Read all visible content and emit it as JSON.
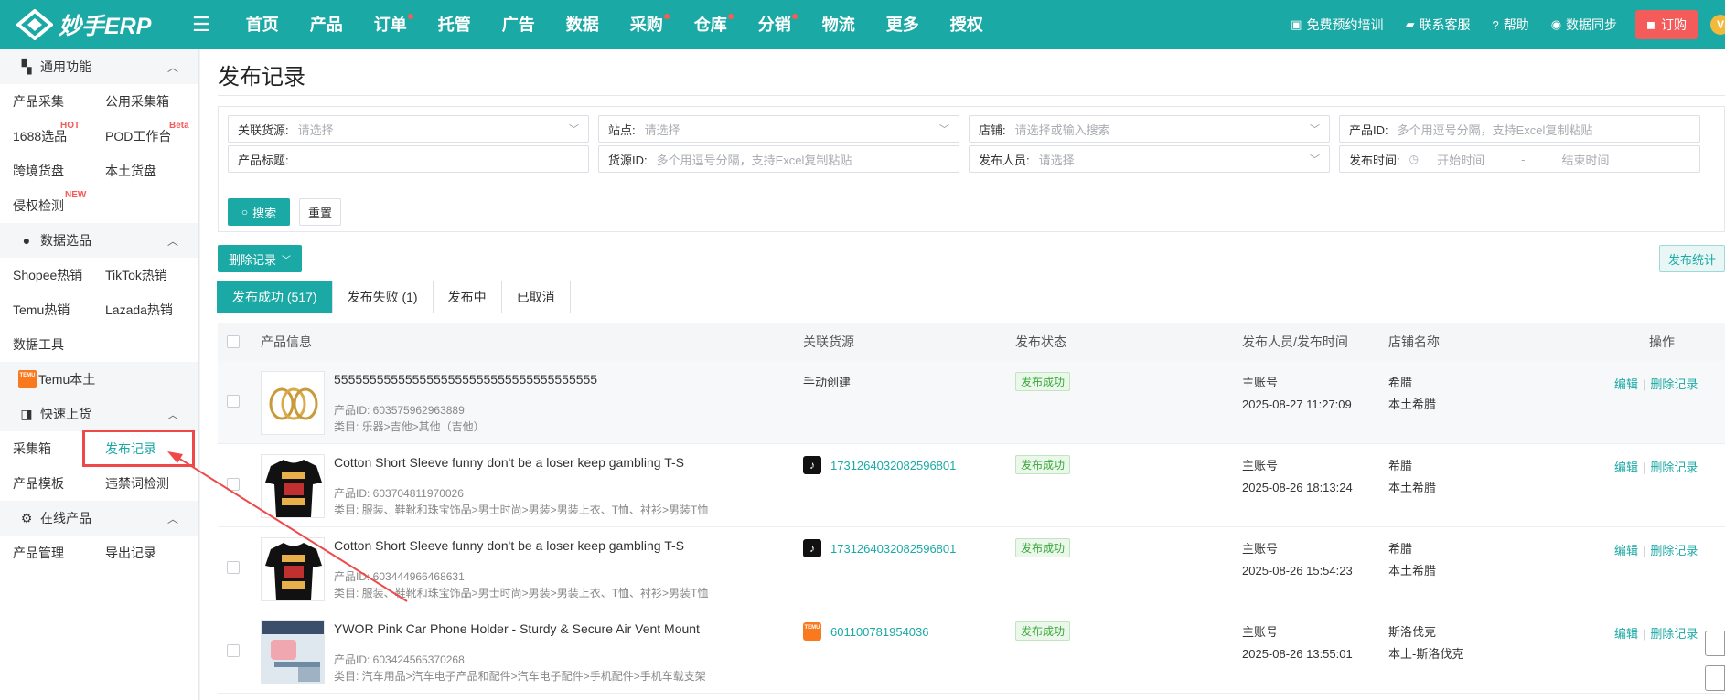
{
  "app": {
    "logo_text": "妙手ERP",
    "nav": [
      {
        "label": "首页",
        "dot": false
      },
      {
        "label": "产品",
        "dot": false
      },
      {
        "label": "订单",
        "dot": true
      },
      {
        "label": "托管",
        "dot": false
      },
      {
        "label": "广告",
        "dot": false
      },
      {
        "label": "数据",
        "dot": false
      },
      {
        "label": "采购",
        "dot": true
      },
      {
        "label": "仓库",
        "dot": true
      },
      {
        "label": "分销",
        "dot": true
      },
      {
        "label": "物流",
        "dot": false
      },
      {
        "label": "更多",
        "dot": false
      },
      {
        "label": "授权",
        "dot": false
      }
    ],
    "top_right": {
      "training": "免费预约培训",
      "support": "联系客服",
      "help": "帮助",
      "sync": "数据同步",
      "order": "订购",
      "vip": "V"
    }
  },
  "sidebar": {
    "sections": [
      {
        "title": "通用功能",
        "icon": "grid-icon",
        "items": [
          {
            "label": "产品采集"
          },
          {
            "label": "公用采集箱"
          },
          {
            "label": "1688选品",
            "tag": "HOT"
          },
          {
            "label": "POD工作台",
            "tag": "Beta"
          },
          {
            "label": "跨境货盘"
          },
          {
            "label": "本土货盘"
          },
          {
            "label": "侵权检测",
            "tag": "NEW"
          }
        ]
      },
      {
        "title": "数据选品",
        "icon": "thumb-icon",
        "items": [
          {
            "label": "Shopee热销"
          },
          {
            "label": "TikTok热销"
          },
          {
            "label": "Temu热销"
          },
          {
            "label": "Lazada热销"
          },
          {
            "label": "数据工具"
          }
        ]
      },
      {
        "title": "快速上货",
        "icon": "bag-icon",
        "items": [
          {
            "label": "采集箱"
          },
          {
            "label": "发布记录",
            "active": true
          },
          {
            "label": "产品模板"
          },
          {
            "label": "违禁词检测"
          }
        ]
      },
      {
        "title": "在线产品",
        "icon": "gear-icon",
        "items": [
          {
            "label": "产品管理"
          },
          {
            "label": "导出记录"
          }
        ]
      }
    ],
    "temu_local": {
      "label": "Temu本土",
      "logo": "TEMU"
    }
  },
  "main": {
    "title": "发布记录",
    "filters": {
      "source": {
        "label": "关联货源:",
        "placeholder": "请选择"
      },
      "site": {
        "label": "站点:",
        "placeholder": "请选择"
      },
      "shop": {
        "label": "店铺:",
        "placeholder": "请选择或输入搜索"
      },
      "product_id": {
        "label": "产品ID:",
        "placeholder": "多个用逗号分隔，支持Excel复制粘贴"
      },
      "product_title": {
        "label": "产品标题:",
        "placeholder": ""
      },
      "source_id": {
        "label": "货源ID:",
        "placeholder": "多个用逗号分隔，支持Excel复制粘贴"
      },
      "publisher": {
        "label": "发布人员:",
        "placeholder": "请选择"
      },
      "publish_time": {
        "label": "发布时间:",
        "start": "开始时间",
        "sep": "-",
        "end": "结束时间"
      }
    },
    "search_label": "搜索",
    "reset_label": "重置",
    "delete_label": "删除记录",
    "stats_label": "发布统计",
    "tabs": [
      {
        "label": "发布成功 (517)",
        "active": true
      },
      {
        "label": "发布失败 (1)",
        "active": false
      },
      {
        "label": "发布中",
        "active": false
      },
      {
        "label": "已取消",
        "active": false
      }
    ],
    "table": {
      "headers": {
        "product": "产品信息",
        "source": "关联货源",
        "status": "发布状态",
        "publisher": "发布人员/发布时间",
        "shop": "店铺名称",
        "ops": "操作"
      },
      "rows": [
        {
          "title": "5555555555555555555555555555555555555",
          "pid": "产品ID: 603575962963889",
          "category": "类目: 乐器>吉他>其他（吉他）",
          "source_type": "manual",
          "source": "手动创建",
          "status": "发布成功",
          "publisher": "主账号",
          "time": "2025-08-27 11:27:09",
          "shop1": "希腊",
          "shop2": "本土希腊",
          "thumb": "rings"
        },
        {
          "title": "Cotton Short Sleeve funny don't be a loser keep gambling T-S",
          "pid": "产品ID: 603704811970026",
          "category": "类目: 服装、鞋靴和珠宝饰品>男士时尚>男装>男装上衣、T恤、衬衫>男装T恤",
          "source_type": "tiktok",
          "source": "1731264032082596801",
          "status": "发布成功",
          "publisher": "主账号",
          "time": "2025-08-26 18:13:24",
          "shop1": "希腊",
          "shop2": "本土希腊",
          "thumb": "tshirt"
        },
        {
          "title": "Cotton Short Sleeve funny don't be a loser keep gambling T-S",
          "pid": "产品ID: 603444966468631",
          "category": "类目: 服装、鞋靴和珠宝饰品>男士时尚>男装>男装上衣、T恤、衬衫>男装T恤",
          "source_type": "tiktok",
          "source": "1731264032082596801",
          "status": "发布成功",
          "publisher": "主账号",
          "time": "2025-08-26 15:54:23",
          "shop1": "希腊",
          "shop2": "本土希腊",
          "thumb": "tshirt"
        },
        {
          "title": "YWOR Pink Car Phone Holder - Sturdy & Secure Air Vent Mount",
          "pid": "产品ID: 603424565370268",
          "category": "类目: 汽车用品>汽车电子产品和配件>汽车电子配件>手机配件>手机车载支架",
          "source_type": "temu",
          "source": "601100781954036",
          "status": "发布成功",
          "publisher": "主账号",
          "time": "2025-08-26 13:55:01",
          "shop1": "斯洛伐克",
          "shop2": "本土-斯洛伐克",
          "thumb": "holder"
        }
      ],
      "ops": {
        "edit": "编辑",
        "delete": "删除记录"
      }
    }
  }
}
